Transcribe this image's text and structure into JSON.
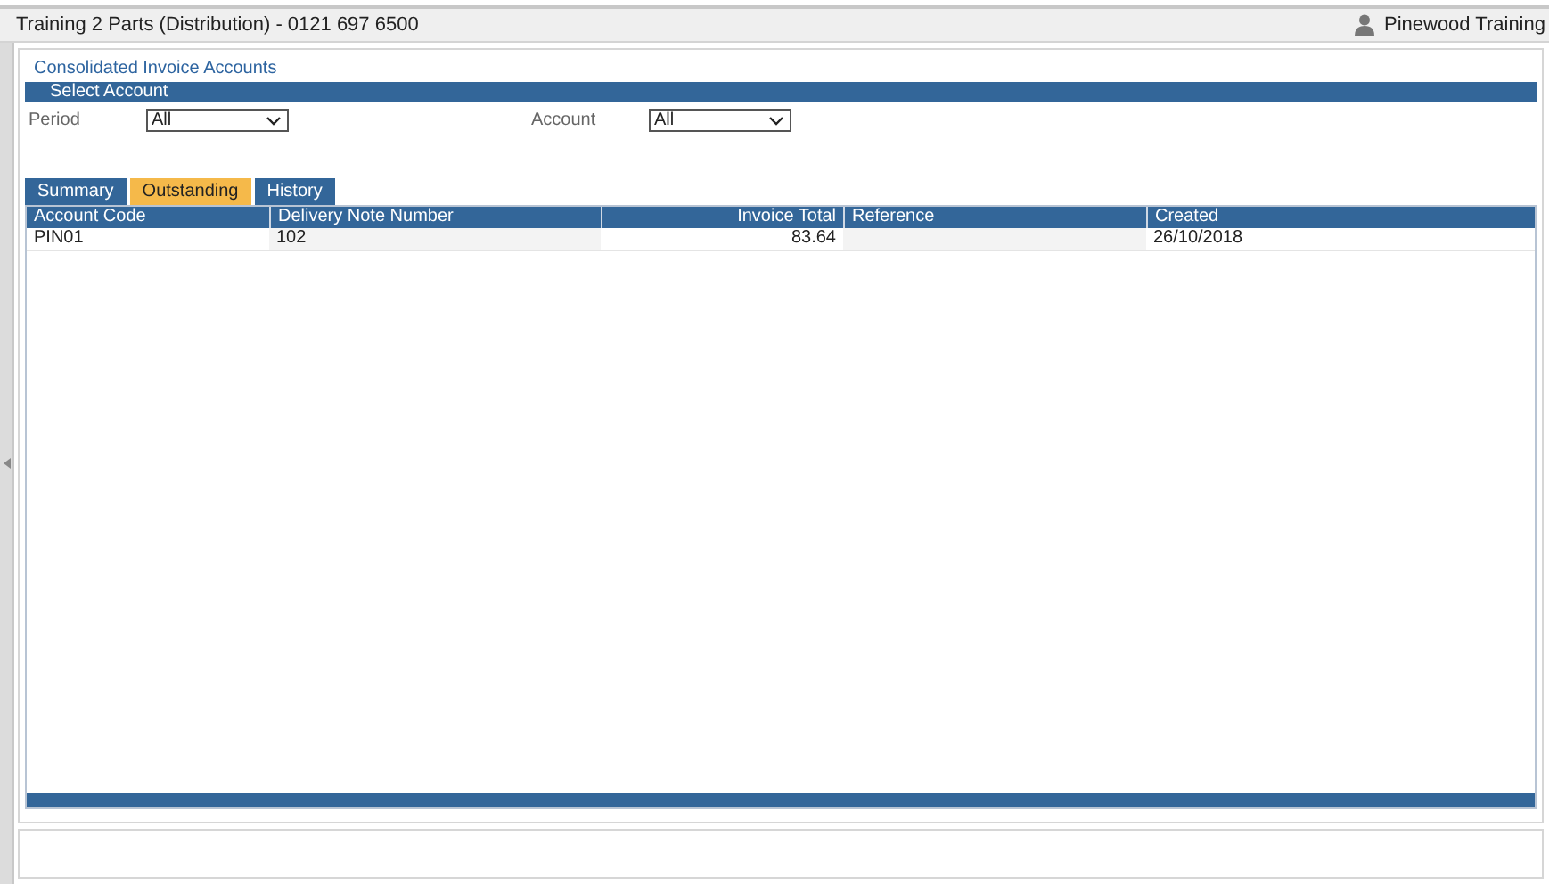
{
  "header": {
    "title": "Training 2 Parts (Distribution) - 0121 697 6500",
    "user": "Pinewood Training"
  },
  "page": {
    "title": "Consolidated Invoice Accounts",
    "section": "Select Account"
  },
  "filters": [
    {
      "label": "Period",
      "value": "All"
    },
    {
      "label": "Account",
      "value": "All"
    }
  ],
  "tabs": [
    {
      "label": "Summary",
      "selected": false
    },
    {
      "label": "Outstanding",
      "selected": true
    },
    {
      "label": "History",
      "selected": false
    }
  ],
  "table": {
    "columns": [
      {
        "label": "Account Code",
        "kind": "text"
      },
      {
        "label": "Delivery Note Number",
        "kind": "text"
      },
      {
        "label": "Invoice Total",
        "kind": "number"
      },
      {
        "label": "Reference",
        "kind": "text"
      },
      {
        "label": "Created",
        "kind": "text"
      }
    ],
    "rows": [
      [
        "PIN01",
        "102",
        "83.64",
        "",
        "26/10/2018"
      ]
    ]
  }
}
